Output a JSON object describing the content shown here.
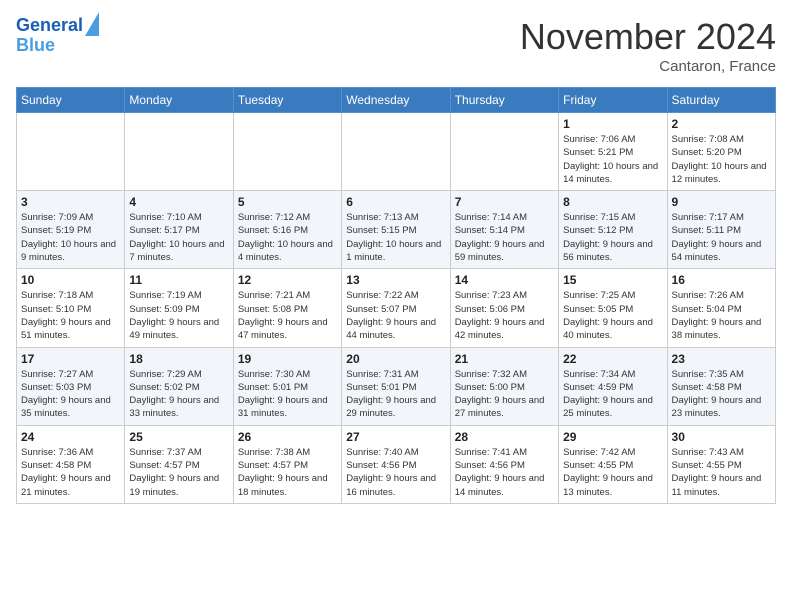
{
  "header": {
    "logo_line1": "General",
    "logo_line2": "Blue",
    "month": "November 2024",
    "location": "Cantaron, France"
  },
  "weekdays": [
    "Sunday",
    "Monday",
    "Tuesday",
    "Wednesday",
    "Thursday",
    "Friday",
    "Saturday"
  ],
  "weeks": [
    [
      {
        "day": "",
        "info": ""
      },
      {
        "day": "",
        "info": ""
      },
      {
        "day": "",
        "info": ""
      },
      {
        "day": "",
        "info": ""
      },
      {
        "day": "",
        "info": ""
      },
      {
        "day": "1",
        "info": "Sunrise: 7:06 AM\nSunset: 5:21 PM\nDaylight: 10 hours and 14 minutes."
      },
      {
        "day": "2",
        "info": "Sunrise: 7:08 AM\nSunset: 5:20 PM\nDaylight: 10 hours and 12 minutes."
      }
    ],
    [
      {
        "day": "3",
        "info": "Sunrise: 7:09 AM\nSunset: 5:19 PM\nDaylight: 10 hours and 9 minutes."
      },
      {
        "day": "4",
        "info": "Sunrise: 7:10 AM\nSunset: 5:17 PM\nDaylight: 10 hours and 7 minutes."
      },
      {
        "day": "5",
        "info": "Sunrise: 7:12 AM\nSunset: 5:16 PM\nDaylight: 10 hours and 4 minutes."
      },
      {
        "day": "6",
        "info": "Sunrise: 7:13 AM\nSunset: 5:15 PM\nDaylight: 10 hours and 1 minute."
      },
      {
        "day": "7",
        "info": "Sunrise: 7:14 AM\nSunset: 5:14 PM\nDaylight: 9 hours and 59 minutes."
      },
      {
        "day": "8",
        "info": "Sunrise: 7:15 AM\nSunset: 5:12 PM\nDaylight: 9 hours and 56 minutes."
      },
      {
        "day": "9",
        "info": "Sunrise: 7:17 AM\nSunset: 5:11 PM\nDaylight: 9 hours and 54 minutes."
      }
    ],
    [
      {
        "day": "10",
        "info": "Sunrise: 7:18 AM\nSunset: 5:10 PM\nDaylight: 9 hours and 51 minutes."
      },
      {
        "day": "11",
        "info": "Sunrise: 7:19 AM\nSunset: 5:09 PM\nDaylight: 9 hours and 49 minutes."
      },
      {
        "day": "12",
        "info": "Sunrise: 7:21 AM\nSunset: 5:08 PM\nDaylight: 9 hours and 47 minutes."
      },
      {
        "day": "13",
        "info": "Sunrise: 7:22 AM\nSunset: 5:07 PM\nDaylight: 9 hours and 44 minutes."
      },
      {
        "day": "14",
        "info": "Sunrise: 7:23 AM\nSunset: 5:06 PM\nDaylight: 9 hours and 42 minutes."
      },
      {
        "day": "15",
        "info": "Sunrise: 7:25 AM\nSunset: 5:05 PM\nDaylight: 9 hours and 40 minutes."
      },
      {
        "day": "16",
        "info": "Sunrise: 7:26 AM\nSunset: 5:04 PM\nDaylight: 9 hours and 38 minutes."
      }
    ],
    [
      {
        "day": "17",
        "info": "Sunrise: 7:27 AM\nSunset: 5:03 PM\nDaylight: 9 hours and 35 minutes."
      },
      {
        "day": "18",
        "info": "Sunrise: 7:29 AM\nSunset: 5:02 PM\nDaylight: 9 hours and 33 minutes."
      },
      {
        "day": "19",
        "info": "Sunrise: 7:30 AM\nSunset: 5:01 PM\nDaylight: 9 hours and 31 minutes."
      },
      {
        "day": "20",
        "info": "Sunrise: 7:31 AM\nSunset: 5:01 PM\nDaylight: 9 hours and 29 minutes."
      },
      {
        "day": "21",
        "info": "Sunrise: 7:32 AM\nSunset: 5:00 PM\nDaylight: 9 hours and 27 minutes."
      },
      {
        "day": "22",
        "info": "Sunrise: 7:34 AM\nSunset: 4:59 PM\nDaylight: 9 hours and 25 minutes."
      },
      {
        "day": "23",
        "info": "Sunrise: 7:35 AM\nSunset: 4:58 PM\nDaylight: 9 hours and 23 minutes."
      }
    ],
    [
      {
        "day": "24",
        "info": "Sunrise: 7:36 AM\nSunset: 4:58 PM\nDaylight: 9 hours and 21 minutes."
      },
      {
        "day": "25",
        "info": "Sunrise: 7:37 AM\nSunset: 4:57 PM\nDaylight: 9 hours and 19 minutes."
      },
      {
        "day": "26",
        "info": "Sunrise: 7:38 AM\nSunset: 4:57 PM\nDaylight: 9 hours and 18 minutes."
      },
      {
        "day": "27",
        "info": "Sunrise: 7:40 AM\nSunset: 4:56 PM\nDaylight: 9 hours and 16 minutes."
      },
      {
        "day": "28",
        "info": "Sunrise: 7:41 AM\nSunset: 4:56 PM\nDaylight: 9 hours and 14 minutes."
      },
      {
        "day": "29",
        "info": "Sunrise: 7:42 AM\nSunset: 4:55 PM\nDaylight: 9 hours and 13 minutes."
      },
      {
        "day": "30",
        "info": "Sunrise: 7:43 AM\nSunset: 4:55 PM\nDaylight: 9 hours and 11 minutes."
      }
    ]
  ]
}
